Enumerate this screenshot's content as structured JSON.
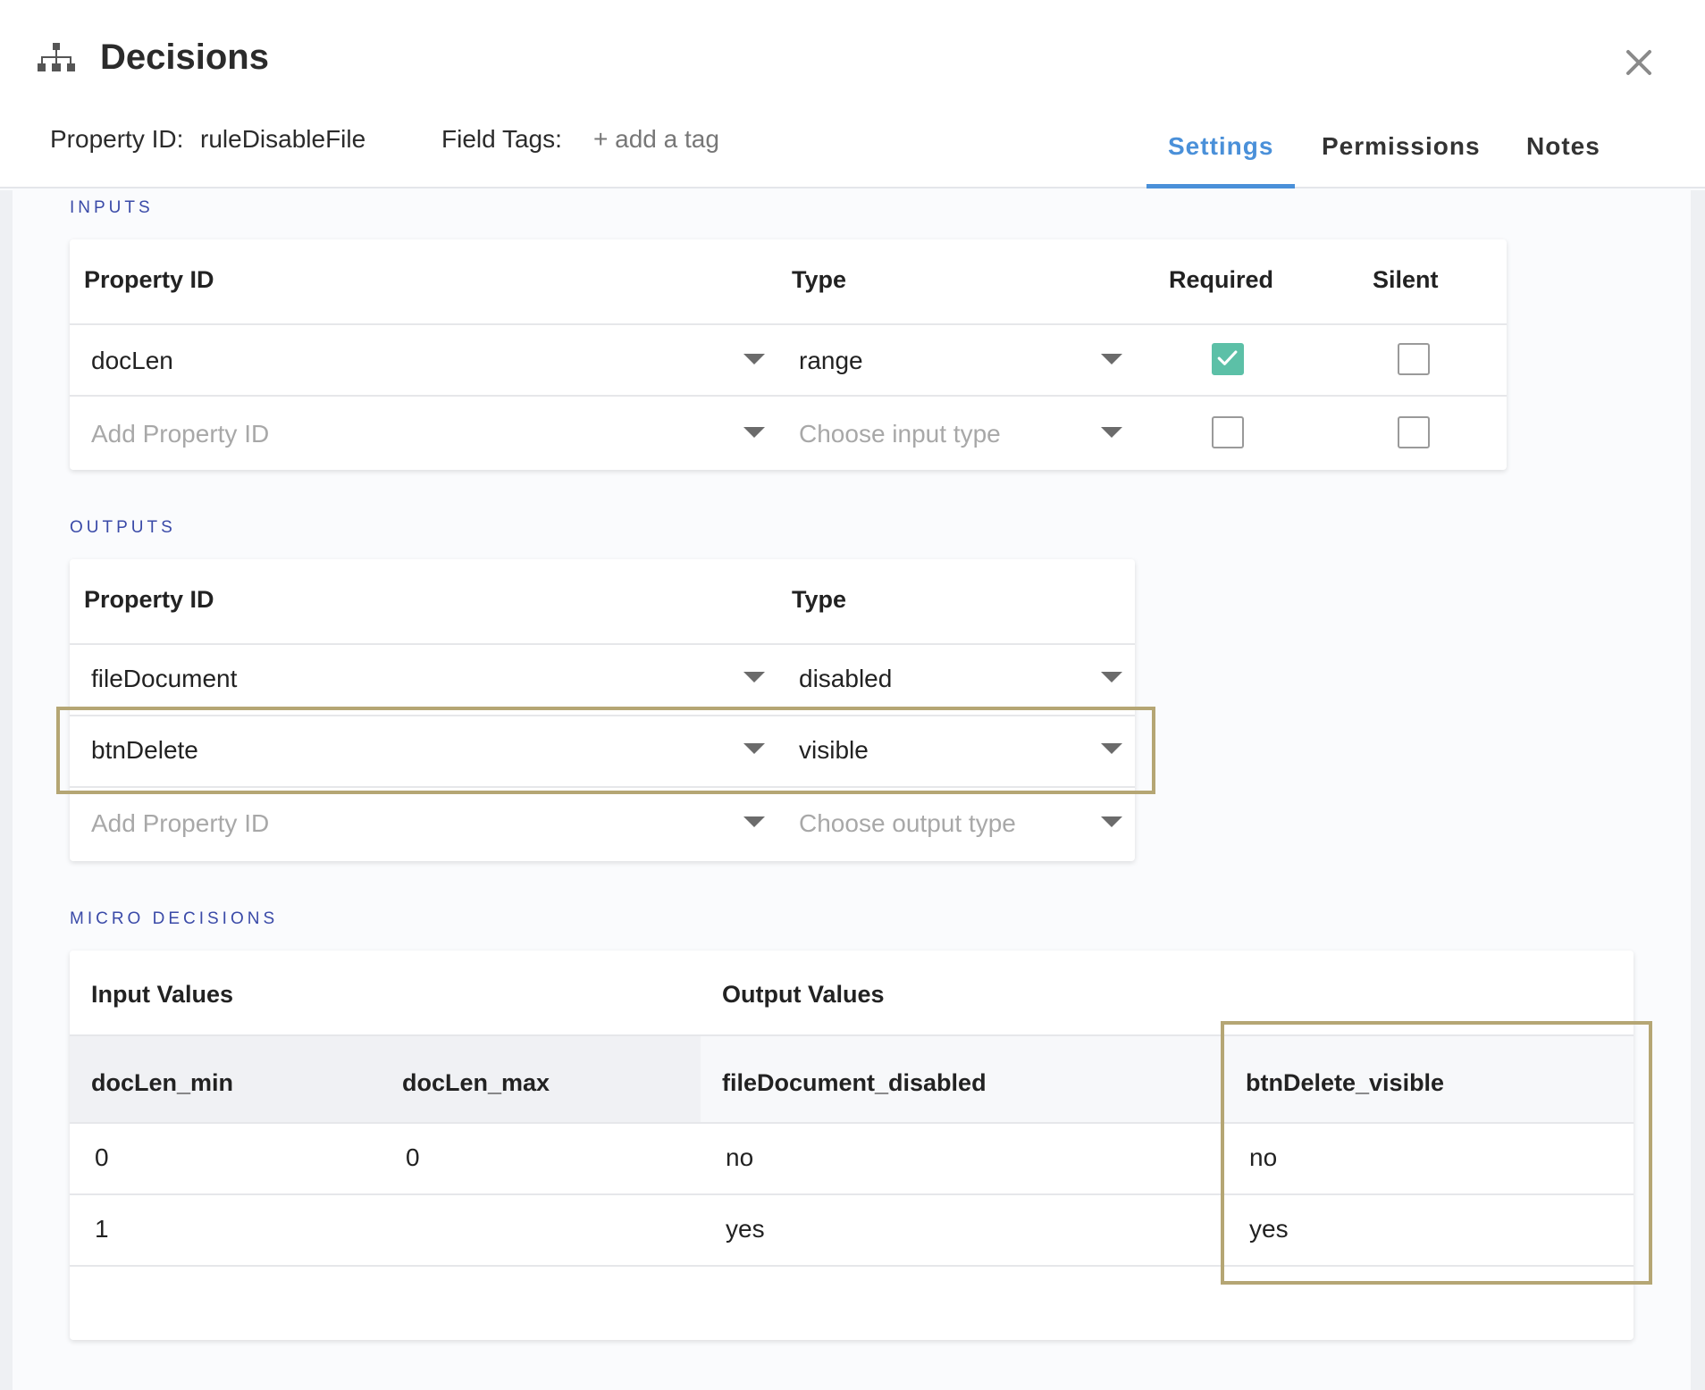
{
  "header": {
    "title": "Decisions",
    "property_id_label": "Property ID:",
    "property_id_value": "ruleDisableFile",
    "field_tags_label": "Field Tags:",
    "add_tag_label": "+ add a tag",
    "tabs": [
      {
        "label": "Settings",
        "active": true
      },
      {
        "label": "Permissions",
        "active": false
      },
      {
        "label": "Notes",
        "active": false
      }
    ],
    "accent_color": "#4a90d9"
  },
  "inputs": {
    "section_label": "INPUTS",
    "columns": [
      "Property ID",
      "Type",
      "Required",
      "Silent"
    ],
    "rows": [
      {
        "property_id": "docLen",
        "type": "range",
        "required": true,
        "silent": false
      },
      {
        "property_id_placeholder": "Add Property ID",
        "type_placeholder": "Choose input type",
        "required": false,
        "silent": false
      }
    ]
  },
  "outputs": {
    "section_label": "OUTPUTS",
    "columns": [
      "Property ID",
      "Type"
    ],
    "rows": [
      {
        "property_id": "fileDocument",
        "type": "disabled"
      },
      {
        "property_id": "btnDelete",
        "type": "visible"
      },
      {
        "property_id_placeholder": "Add Property ID",
        "type_placeholder": "Choose output type"
      }
    ]
  },
  "micro_decisions": {
    "section_label": "MICRO DECISIONS",
    "group_headers": [
      "Input Values",
      "Output Values"
    ],
    "columns": [
      "docLen_min",
      "docLen_max",
      "fileDocument_disabled",
      "btnDelete_visible"
    ],
    "rows": [
      [
        "0",
        "0",
        "no",
        "no"
      ],
      [
        "1",
        "",
        "yes",
        "yes"
      ]
    ]
  },
  "icons": {
    "title_icon": "hierarchy-icon",
    "close_icon": "close-icon",
    "check_icon": "check-icon"
  },
  "colors": {
    "section_label": "#3a4aa8",
    "checkbox_checked": "#5cc0a7",
    "highlight_border": "#b5a674"
  }
}
